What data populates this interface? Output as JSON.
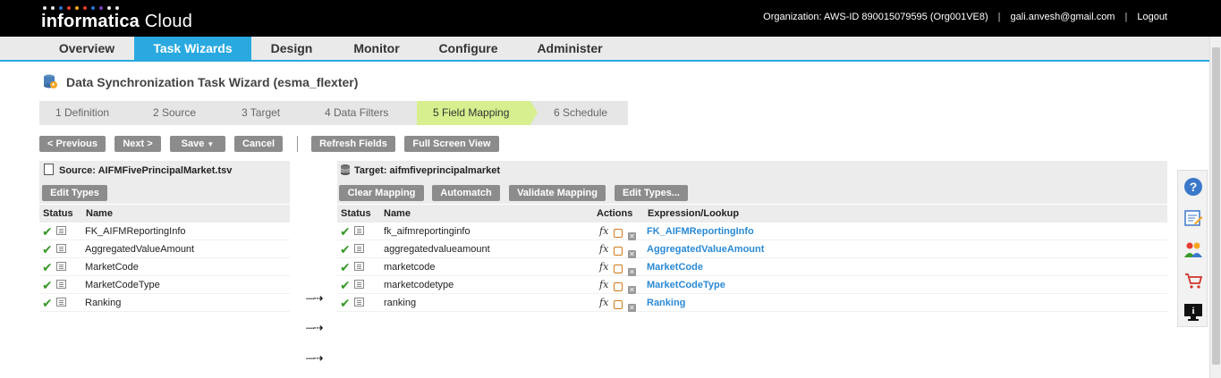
{
  "header": {
    "brand_bold": "informatica",
    "brand_light": "Cloud",
    "logo_dot_colors": [
      "#e8e8e8",
      "#e8e8e8",
      "#2f6fd1",
      "#e63b2e",
      "#f5a623",
      "#e63b2e",
      "#2f6fd1",
      "#7a3fb5",
      "#e8e8e8",
      "#e8e8e8"
    ],
    "organization": "Organization: AWS-ID 890015079595 (Org001VE8)",
    "user": "gali.anvesh@gmail.com",
    "logout": "Logout"
  },
  "nav": {
    "tabs": [
      {
        "label": "Overview",
        "active": false
      },
      {
        "label": "Task Wizards",
        "active": true
      },
      {
        "label": "Design",
        "active": false
      },
      {
        "label": "Monitor",
        "active": false
      },
      {
        "label": "Configure",
        "active": false
      },
      {
        "label": "Administer",
        "active": false
      }
    ],
    "active_color": "#29a9e0"
  },
  "page": {
    "title": "Data Synchronization Task Wizard (esma_flexter)"
  },
  "steps": [
    {
      "label": "1  Definition",
      "active": false
    },
    {
      "label": "2  Source",
      "active": false
    },
    {
      "label": "3  Target",
      "active": false
    },
    {
      "label": "4  Data Filters",
      "active": false
    },
    {
      "label": "5  Field Mapping",
      "active": true
    },
    {
      "label": "6  Schedule",
      "active": false
    }
  ],
  "toolbar": {
    "previous": "< Previous",
    "next": "Next >",
    "save": "Save",
    "cancel": "Cancel",
    "refresh": "Refresh Fields",
    "fullscreen": "Full Screen View"
  },
  "source": {
    "header": "Source: AIFMFivePrincipalMarket.tsv",
    "edit_types": "Edit Types",
    "columns": {
      "status": "Status",
      "name": "Name"
    },
    "rows": [
      {
        "name": "FK_AIFMReportingInfo"
      },
      {
        "name": "AggregatedValueAmount"
      },
      {
        "name": "MarketCode"
      },
      {
        "name": "MarketCodeType"
      },
      {
        "name": "Ranking"
      }
    ]
  },
  "target": {
    "header": "Target: aifmfiveprincipalmarket",
    "clear_mapping": "Clear Mapping",
    "automatch": "Automatch",
    "validate_mapping": "Validate Mapping",
    "edit_types": "Edit Types...",
    "columns": {
      "status": "Status",
      "name": "Name",
      "actions": "Actions",
      "expression": "Expression/Lookup"
    },
    "rows": [
      {
        "name": "fk_aifmreportinginfo",
        "expression": "FK_AIFMReportingInfo"
      },
      {
        "name": "aggregatedvalueamount",
        "expression": "AggregatedValueAmount"
      },
      {
        "name": "marketcode",
        "expression": "MarketCode"
      },
      {
        "name": "marketcodetype",
        "expression": "MarketCodeType"
      },
      {
        "name": "ranking",
        "expression": "Ranking"
      }
    ]
  },
  "side_icons": [
    "help-icon",
    "edit-notes-icon",
    "community-icon",
    "cart-icon",
    "info-monitor-icon"
  ]
}
